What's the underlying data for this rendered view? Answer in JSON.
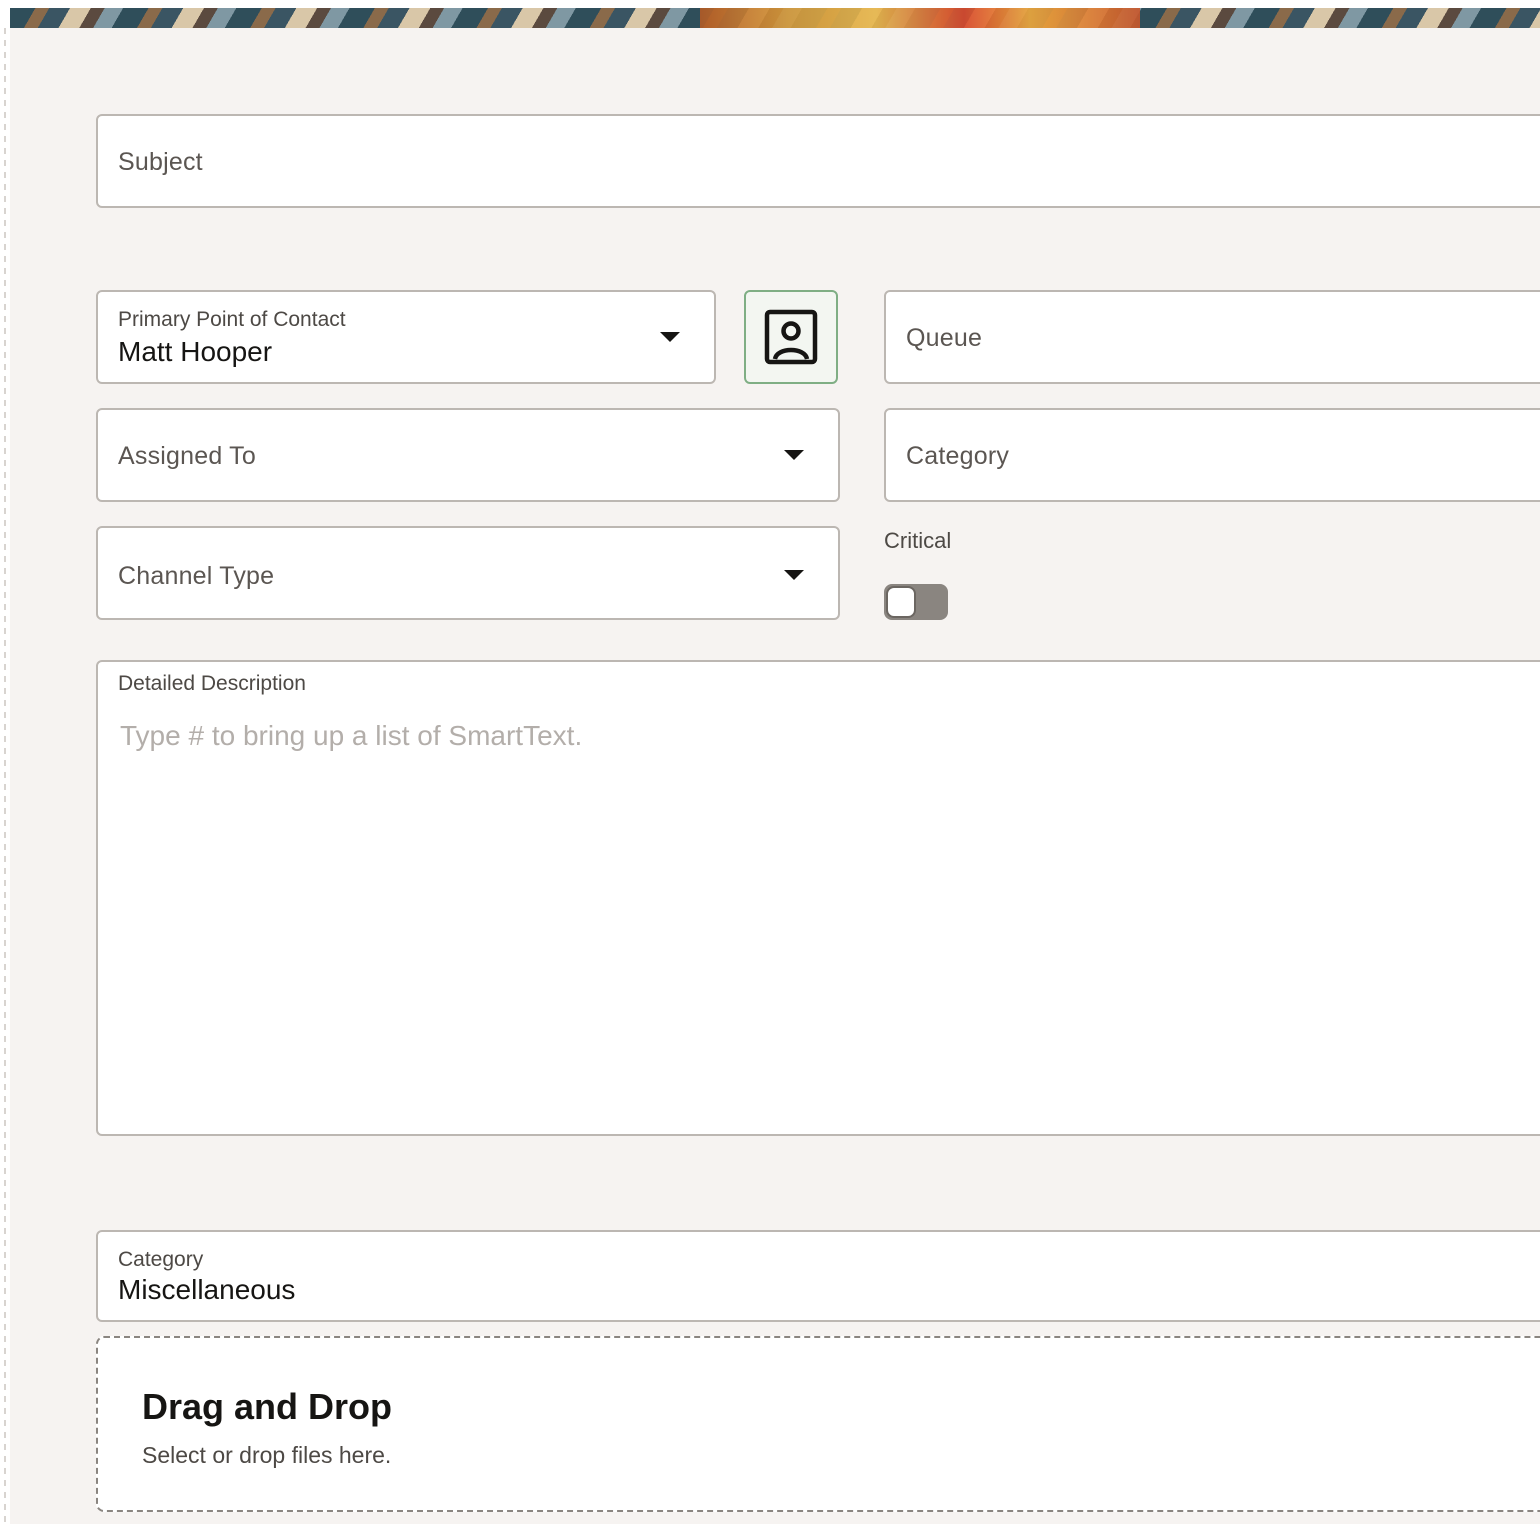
{
  "form": {
    "subject": {
      "placeholder": "Subject"
    },
    "primary_contact": {
      "label": "Primary Point of Contact",
      "value": "Matt Hooper"
    },
    "contact_button": {
      "icon": "contact-card-icon"
    },
    "queue": {
      "placeholder": "Queue"
    },
    "assigned_to": {
      "placeholder": "Assigned To"
    },
    "category_select": {
      "placeholder": "Category"
    },
    "channel_type": {
      "placeholder": "Channel Type"
    },
    "critical": {
      "label": "Critical",
      "checked": false
    },
    "description": {
      "label": "Detailed Description",
      "placeholder": "Type # to bring up a list of SmartText."
    },
    "attachment_category": {
      "label": "Category",
      "value": "Miscellaneous"
    },
    "dropzone": {
      "title": "Drag and Drop",
      "subtitle": "Select or drop files here."
    }
  },
  "colors": {
    "panel_bg": "#f6f3f1",
    "field_border": "#bcb7b2",
    "contact_button_border": "#7fae84",
    "toggle_off": "#8a8580"
  }
}
